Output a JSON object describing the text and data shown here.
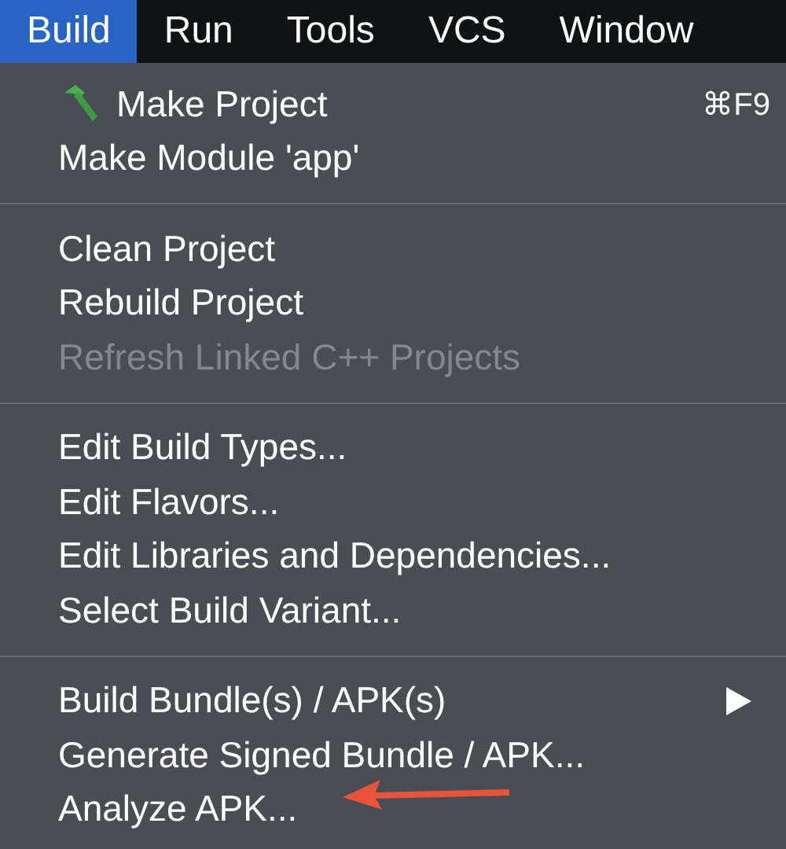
{
  "menubar": [
    {
      "label": "Build",
      "selected": true
    },
    {
      "label": "Run",
      "selected": false
    },
    {
      "label": "Tools",
      "selected": false
    },
    {
      "label": "VCS",
      "selected": false
    },
    {
      "label": "Window",
      "selected": false
    }
  ],
  "menu": {
    "sections": [
      {
        "items": [
          {
            "label": "Make Project",
            "kind": "tool",
            "shortcut": "⌘F9",
            "disabled": false
          },
          {
            "label": "Make Module 'app'",
            "kind": "plain",
            "disabled": false
          }
        ]
      },
      {
        "items": [
          {
            "label": "Clean Project",
            "kind": "plain",
            "disabled": false
          },
          {
            "label": "Rebuild Project",
            "kind": "plain",
            "disabled": false
          },
          {
            "label": "Refresh Linked C++ Projects",
            "kind": "plain",
            "disabled": true
          }
        ]
      },
      {
        "items": [
          {
            "label": "Edit Build Types...",
            "kind": "plain",
            "disabled": false
          },
          {
            "label": "Edit Flavors...",
            "kind": "plain",
            "disabled": false
          },
          {
            "label": "Edit Libraries and Dependencies...",
            "kind": "plain",
            "disabled": false
          },
          {
            "label": "Select Build Variant...",
            "kind": "plain",
            "disabled": false
          }
        ]
      },
      {
        "items": [
          {
            "label": "Build Bundle(s) / APK(s)",
            "kind": "submenu",
            "disabled": false
          },
          {
            "label": "Generate Signed Bundle / APK...",
            "kind": "plain",
            "disabled": false
          },
          {
            "label": "Analyze APK...",
            "kind": "plain",
            "disabled": false
          }
        ]
      }
    ]
  }
}
